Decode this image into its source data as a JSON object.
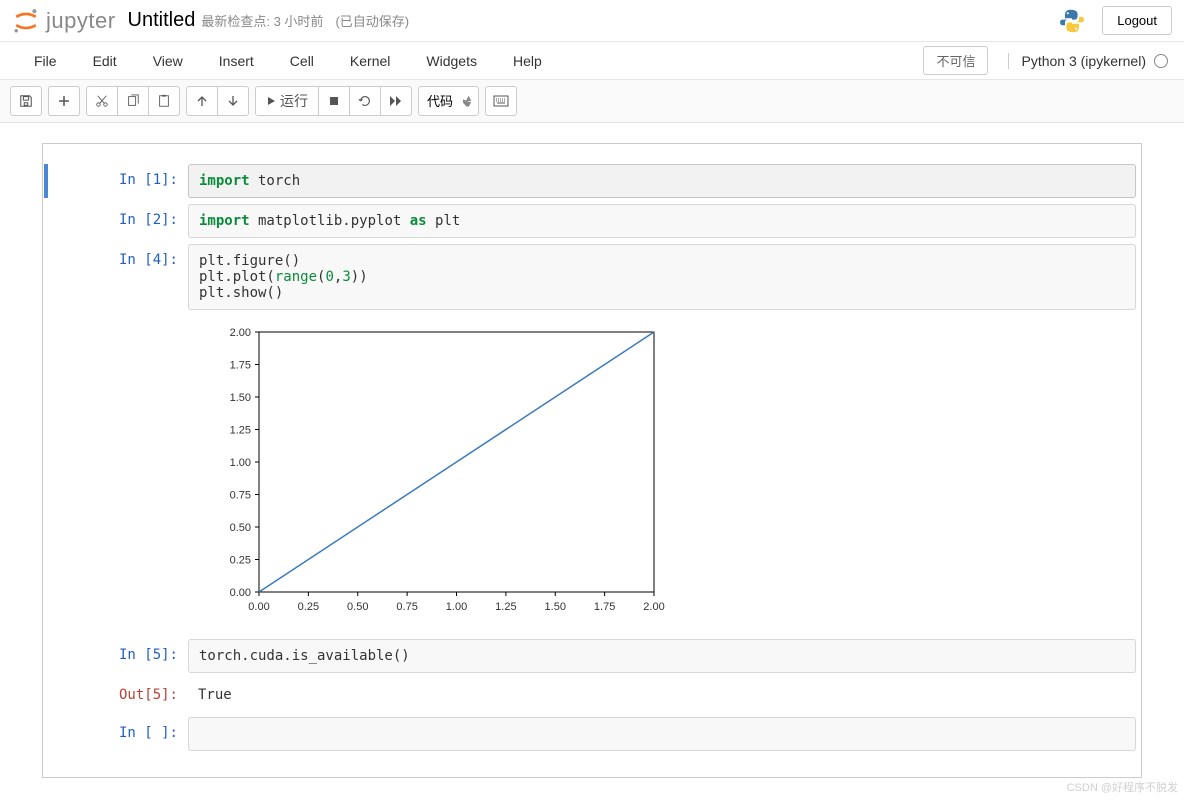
{
  "header": {
    "logo_text": "jupyter",
    "notebook_name": "Untitled",
    "checkpoint": "最新检查点: 3 小时前",
    "autosave": "(已自动保存)",
    "logout": "Logout"
  },
  "menubar": {
    "items": [
      "File",
      "Edit",
      "View",
      "Insert",
      "Cell",
      "Kernel",
      "Widgets",
      "Help"
    ],
    "trust": "不可信",
    "kernel": "Python 3 (ipykernel)"
  },
  "toolbar": {
    "run_label": "运行",
    "cell_type": "代码"
  },
  "cells": [
    {
      "type": "code",
      "in_prompt": "In [1]:",
      "tokens": [
        [
          "kw",
          "import"
        ],
        [
          "txt",
          " torch"
        ]
      ],
      "selected": true
    },
    {
      "type": "code",
      "in_prompt": "In [2]:",
      "tokens": [
        [
          "kw",
          "import"
        ],
        [
          "txt",
          " matplotlib.pyplot "
        ],
        [
          "kw",
          "as"
        ],
        [
          "txt",
          " plt"
        ]
      ]
    },
    {
      "type": "code",
      "in_prompt": "In [4]:",
      "lines": [
        [
          [
            "txt",
            "plt.figure()"
          ]
        ],
        [
          [
            "txt",
            "plt.plot("
          ],
          [
            "builtin",
            "range"
          ],
          [
            "txt",
            "("
          ],
          [
            "num",
            "0"
          ],
          [
            "txt",
            ","
          ],
          [
            "num",
            "3"
          ],
          [
            "txt",
            "))"
          ]
        ],
        [
          [
            "txt",
            "plt.show()"
          ]
        ]
      ],
      "chart": true
    },
    {
      "type": "code",
      "in_prompt": "In [5]:",
      "tokens": [
        [
          "txt",
          "torch.cuda.is_available()"
        ]
      ],
      "out_prompt": "Out[5]:",
      "output": "True"
    },
    {
      "type": "code",
      "in_prompt": "In [ ]:",
      "tokens": []
    }
  ],
  "chart_data": {
    "type": "line",
    "x": [
      0,
      1,
      2
    ],
    "y": [
      0,
      1,
      2
    ],
    "xlim": [
      0,
      2
    ],
    "ylim": [
      0,
      2
    ],
    "xticks": [
      0.0,
      0.25,
      0.5,
      0.75,
      1.0,
      1.25,
      1.5,
      1.75,
      2.0
    ],
    "yticks": [
      0.0,
      0.25,
      0.5,
      0.75,
      1.0,
      1.25,
      1.5,
      1.75,
      2.0
    ],
    "xtick_labels": [
      "0.00",
      "0.25",
      "0.50",
      "0.75",
      "1.00",
      "1.25",
      "1.50",
      "1.75",
      "2.00"
    ],
    "ytick_labels": [
      "0.00",
      "0.25",
      "0.50",
      "0.75",
      "1.00",
      "1.25",
      "1.50",
      "1.75",
      "2.00"
    ]
  },
  "watermark": "CSDN @好程序不脱发"
}
